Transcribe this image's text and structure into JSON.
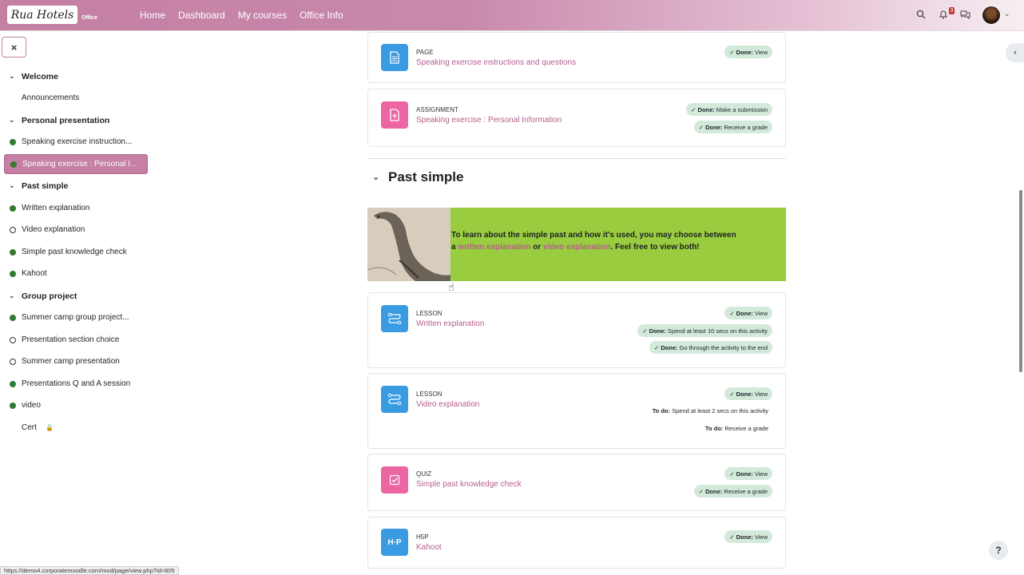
{
  "navbar": {
    "logo_text": "Rua Hotels",
    "logo_sub": "Office",
    "links": [
      "Home",
      "Dashboard",
      "My courses",
      "Office Info"
    ],
    "notification_count": "3"
  },
  "drawer": {
    "close_label": "×",
    "items": [
      {
        "label": "Welcome",
        "kind": "section"
      },
      {
        "label": "Announcements",
        "kind": "plain"
      },
      {
        "label": "Personal presentation",
        "kind": "section"
      },
      {
        "label": "Speaking exercise instruction...",
        "kind": "done"
      },
      {
        "label": "Speaking exercise : Personal I...",
        "kind": "done",
        "active": true
      },
      {
        "label": "Past simple",
        "kind": "section"
      },
      {
        "label": "Written explanation",
        "kind": "done"
      },
      {
        "label": "Video explanation",
        "kind": "todo"
      },
      {
        "label": "Simple past knowledge check",
        "kind": "done"
      },
      {
        "label": "Kahoot",
        "kind": "done"
      },
      {
        "label": "Group project",
        "kind": "section"
      },
      {
        "label": "Summer camp group project...",
        "kind": "done"
      },
      {
        "label": "Presentation section choice",
        "kind": "todo"
      },
      {
        "label": "Summer camp presentation",
        "kind": "todo"
      },
      {
        "label": "Presentations Q and A session",
        "kind": "done"
      },
      {
        "label": "video",
        "kind": "done"
      },
      {
        "label": "Cert",
        "kind": "locked"
      }
    ]
  },
  "activities": [
    {
      "type": "PAGE",
      "name": "Speaking exercise instructions and questions",
      "conditions": [
        {
          "status": "Done:",
          "text": "View"
        }
      ]
    },
    {
      "type": "ASSIGNMENT",
      "name": "Speaking exercise : Personal Information",
      "conditions": [
        {
          "status": "Done:",
          "text": "Make a submission"
        },
        {
          "status": "Done:",
          "text": "Receive a grade"
        }
      ]
    },
    {
      "type": "LESSON",
      "name": "Written explanation",
      "conditions": [
        {
          "status": "Done:",
          "text": "View"
        },
        {
          "status": "Done:",
          "text": "Spend at least 10 secs on this activity"
        },
        {
          "status": "Done:",
          "text": "Go through the activity to the end"
        }
      ]
    },
    {
      "type": "LESSON",
      "name": "Video explanation",
      "conditions": [
        {
          "status": "Done:",
          "text": "View"
        },
        {
          "status": "To do:",
          "text": "Spend at least 2 secs on this activity"
        },
        {
          "status": "To do:",
          "text": "Receive a grade"
        }
      ]
    },
    {
      "type": "QUIZ",
      "name": "Simple past knowledge check",
      "conditions": [
        {
          "status": "Done:",
          "text": "View"
        },
        {
          "status": "Done:",
          "text": "Receive a grade"
        }
      ]
    },
    {
      "type": "H5P",
      "name": "Kahoot",
      "conditions": [
        {
          "status": "Done:",
          "text": "View"
        }
      ]
    }
  ],
  "section": {
    "title": "Past simple"
  },
  "banner": {
    "text_1": "To learn about the simple past and how it's used, you may choose between a ",
    "link_1": "written explanation",
    "text_2": " or ",
    "link_2": "video explanation",
    "text_3": ". Feel free to view both!"
  },
  "status_url": "https://demo4.corporatemoodle.com/mod/page/view.php?id=805",
  "help_label": "?"
}
